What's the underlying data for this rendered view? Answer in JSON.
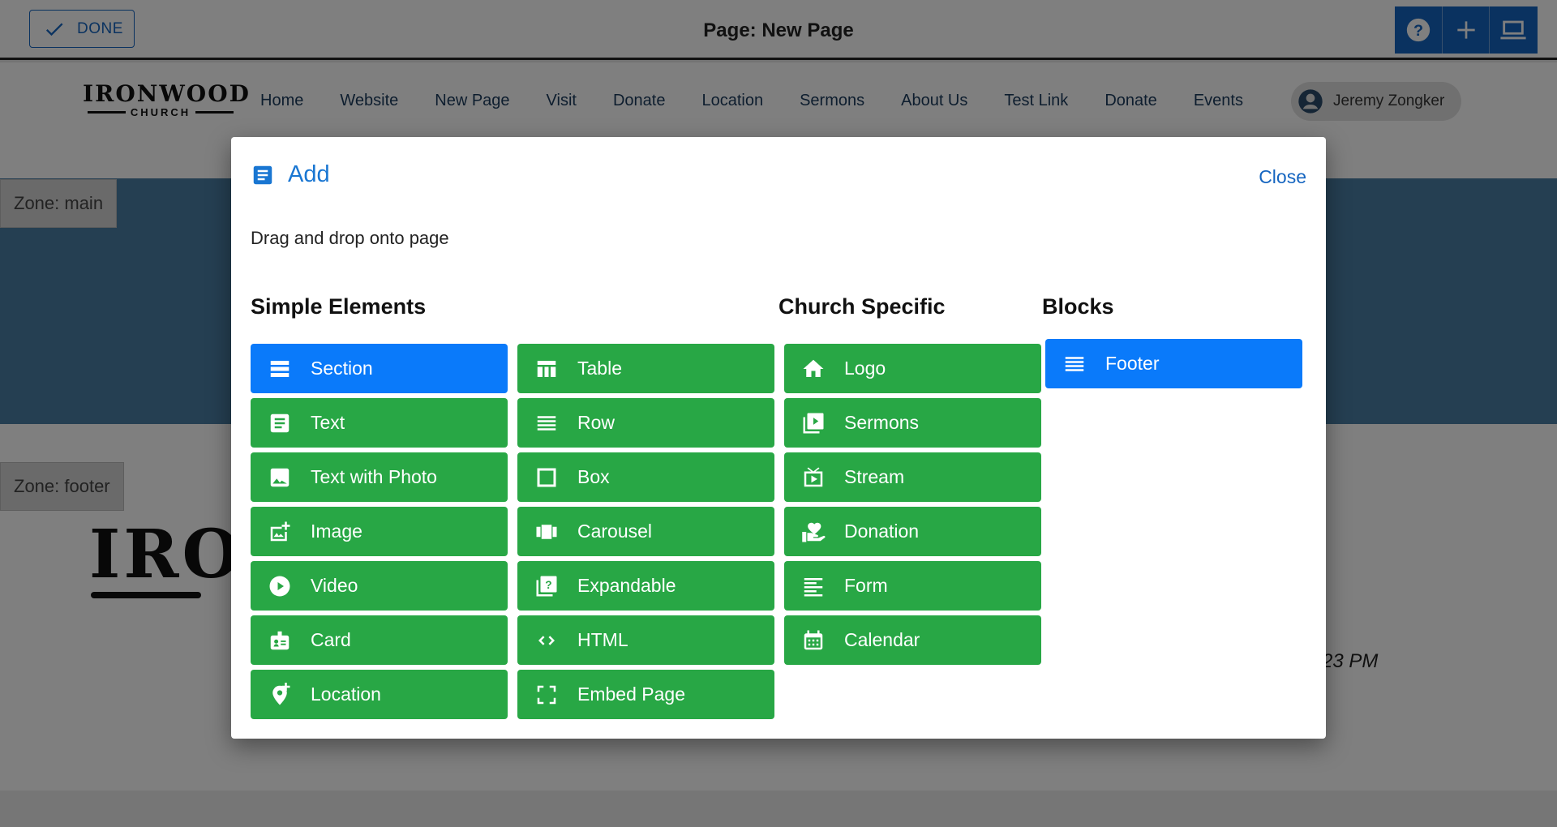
{
  "editor": {
    "done_label": "DONE",
    "page_title": "Page: New Page",
    "tools": [
      "help-icon",
      "add-icon",
      "laptop-icon"
    ]
  },
  "site": {
    "logo_main": "IRONWOOD",
    "logo_sub": "CHURCH",
    "nav": [
      "Home",
      "Website",
      "New Page",
      "Visit",
      "Donate",
      "Location",
      "Sermons",
      "About Us",
      "Test Link",
      "Donate",
      "Events"
    ],
    "user_name": "Jeremy Zongker",
    "zone_main_label": "Zone: main",
    "zone_footer_label": "Zone: footer",
    "footer_logo_partial": "IRO",
    "footer_time_partial": "23 PM"
  },
  "modal": {
    "title": "Add",
    "close_label": "Close",
    "hint": "Drag and drop onto page",
    "sections": {
      "simple": "Simple Elements",
      "church": "Church Specific",
      "blocks": "Blocks"
    },
    "simple_col1": [
      {
        "label": "Section",
        "icon": "section-icon",
        "color": "#0a7afa"
      },
      {
        "label": "Text",
        "icon": "text-icon",
        "color": "#28a745"
      },
      {
        "label": "Text with Photo",
        "icon": "photo-icon",
        "color": "#28a745"
      },
      {
        "label": "Image",
        "icon": "add-photo-icon",
        "color": "#28a745"
      },
      {
        "label": "Video",
        "icon": "play-circle-icon",
        "color": "#28a745"
      },
      {
        "label": "Card",
        "icon": "badge-icon",
        "color": "#28a745"
      },
      {
        "label": "Location",
        "icon": "add-location-icon",
        "color": "#28a745"
      }
    ],
    "simple_col2": [
      {
        "label": "Table",
        "icon": "table-icon",
        "color": "#28a745"
      },
      {
        "label": "Row",
        "icon": "row-icon",
        "color": "#28a745"
      },
      {
        "label": "Box",
        "icon": "box-icon",
        "color": "#28a745"
      },
      {
        "label": "Carousel",
        "icon": "carousel-icon",
        "color": "#28a745"
      },
      {
        "label": "Expandable",
        "icon": "expandable-icon",
        "color": "#28a745"
      },
      {
        "label": "HTML",
        "icon": "code-icon",
        "color": "#28a745"
      },
      {
        "label": "Embed Page",
        "icon": "fullscreen-icon",
        "color": "#28a745"
      }
    ],
    "church": [
      {
        "label": "Logo",
        "icon": "home-icon",
        "color": "#28a745"
      },
      {
        "label": "Sermons",
        "icon": "video-library-icon",
        "color": "#28a745"
      },
      {
        "label": "Stream",
        "icon": "live-tv-icon",
        "color": "#28a745"
      },
      {
        "label": "Donation",
        "icon": "volunteer-icon",
        "color": "#28a745"
      },
      {
        "label": "Form",
        "icon": "form-icon",
        "color": "#28a745"
      },
      {
        "label": "Calendar",
        "icon": "calendar-icon",
        "color": "#28a745"
      }
    ],
    "blocks": [
      {
        "label": "Footer",
        "icon": "footer-icon",
        "color": "#0a7afa"
      }
    ]
  }
}
